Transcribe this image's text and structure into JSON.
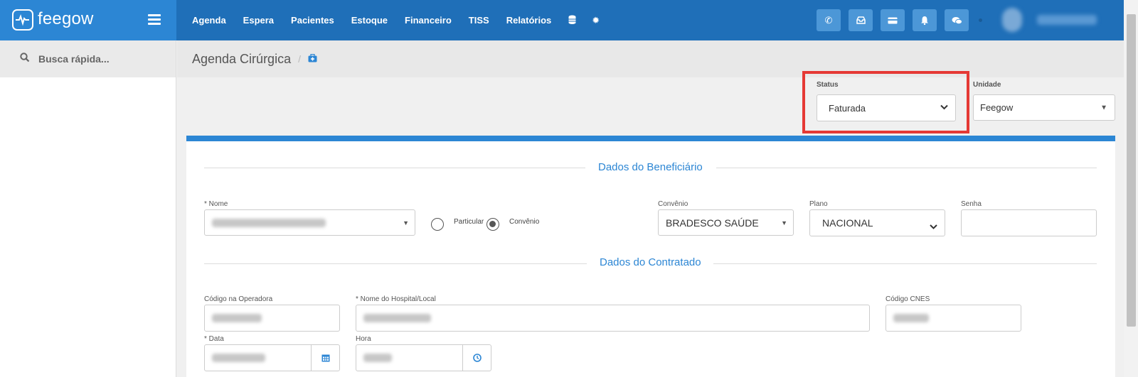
{
  "brand": {
    "name": "feegow"
  },
  "nav": [
    {
      "label": "Agenda"
    },
    {
      "label": "Espera"
    },
    {
      "label": "Pacientes"
    },
    {
      "label": "Estoque"
    },
    {
      "label": "Financeiro"
    },
    {
      "label": "TISS"
    },
    {
      "label": "Relatórios"
    }
  ],
  "nav_icons": [
    "database-icon",
    "gear-icon"
  ],
  "tools": [
    "phone-icon",
    "inbox-icon",
    "card-icon",
    "bell-icon",
    "chat-icon"
  ],
  "colors": {
    "topbar": "#1f6fb8",
    "brand": "#2c86d4",
    "accent": "#2c86d4",
    "highlight": "#e53935"
  },
  "search": {
    "placeholder": "Busca rápida..."
  },
  "page": {
    "title": "Agenda Cirúrgica",
    "separator": "/"
  },
  "filters": {
    "status_label": "Status",
    "status_value": "Faturada",
    "unidade_label": "Unidade",
    "unidade_value": "Feegow"
  },
  "beneficiario": {
    "section_title": "Dados do Beneficiário",
    "nome_label": "* Nome",
    "radio_particular": "Particular",
    "radio_convenio": "Convênio",
    "radio_selected": "Convênio",
    "convenio_label": "Convênio",
    "convenio_value": "BRADESCO SAÚDE",
    "plano_label": "Plano",
    "plano_value": "NACIONAL",
    "senha_label": "Senha",
    "senha_value": ""
  },
  "contratado": {
    "section_title": "Dados do Contratado",
    "codigo_operadora_label": "Código na Operadora",
    "hospital_label": "* Nome do Hospital/Local",
    "cnes_label": "Código CNES",
    "data_label": "* Data",
    "hora_label": "Hora"
  }
}
